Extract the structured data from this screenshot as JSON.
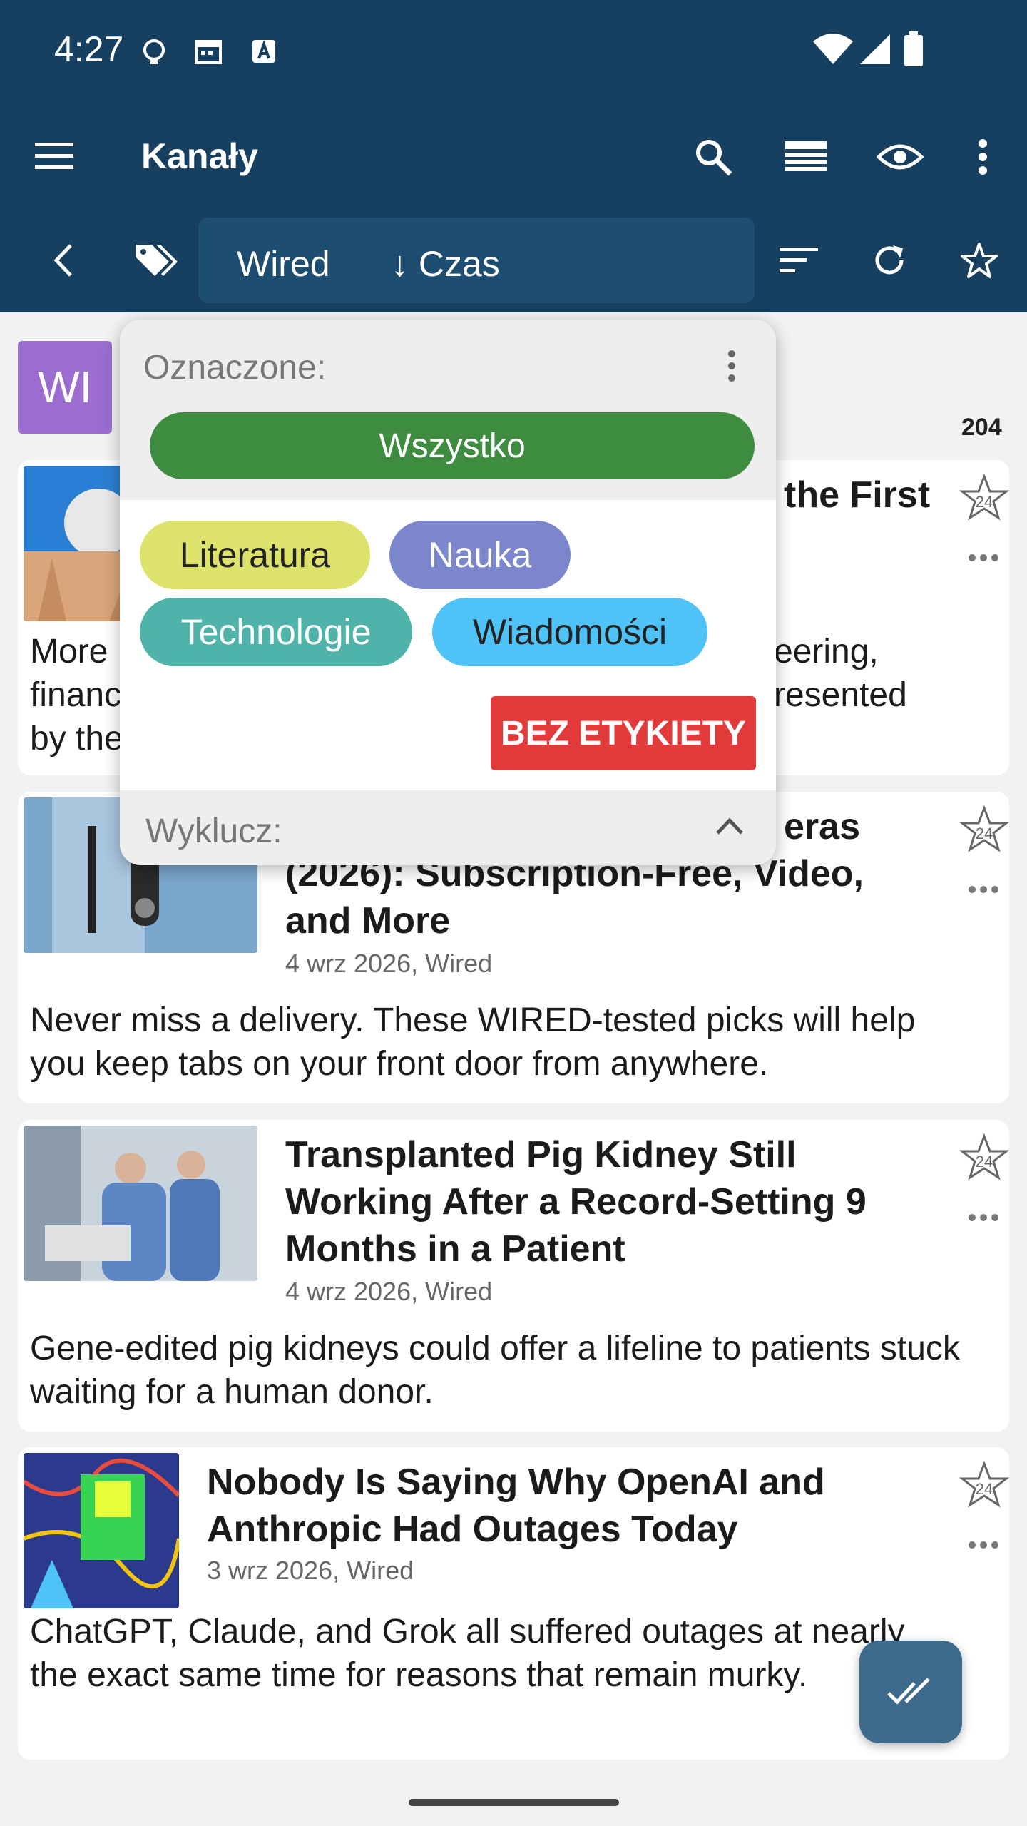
{
  "status_bar": {
    "time": "4:27"
  },
  "app_bar": {
    "title": "Kanały",
    "feed_name": "Wired",
    "sort_label": "↓ Czas"
  },
  "feed": {
    "avatar_text": "WI",
    "count": "204"
  },
  "articles": [
    {
      "title_visible": "the First",
      "summary_left": [
        "More",
        "financ",
        "by the"
      ],
      "summary_right": [
        "eering,",
        "resented"
      ]
    },
    {
      "title_visible_partial": "eras",
      "title_rest": "(2026): Subscription-Free, Video, and More",
      "meta": "4 wrz 2026, Wired",
      "summary": "Never miss a delivery. These WIRED-tested picks will help you keep tabs on your front door from anywhere."
    },
    {
      "title": "Transplanted Pig Kidney Still Working After a Record-Setting 9 Months in a Patient",
      "meta": "4 wrz 2026, Wired",
      "summary": "Gene-edited pig kidneys could offer a lifeline to patients stuck waiting for a human donor."
    },
    {
      "title": "Nobody Is Saying Why OpenAI and Anthropic Had Outages Today",
      "meta": "3 wrz 2026, Wired",
      "summary": "ChatGPT, Claude, and Grok all suffered outages at nearly the exact same time for reasons that remain murky."
    }
  ],
  "tag_popup": {
    "include_label": "Oznaczone:",
    "all_button": "Wszystko",
    "tags": [
      {
        "label": "Literatura",
        "color": "#dde26a"
      },
      {
        "label": "Nauka",
        "color": "#7b86cc"
      },
      {
        "label": "Technologie",
        "color": "#4fb3a9"
      },
      {
        "label": "Wiadomości",
        "color": "#4fc3f7"
      }
    ],
    "untagged_button": "BEZ ETYKIETY",
    "exclude_label": "Wyklucz:"
  },
  "colors": {
    "app_bar": "#173f5f",
    "filter_chip": "#1e4d72",
    "accent_green": "#3d8c40",
    "untagged_red": "#e03a3a",
    "fab": "#3e6a8c"
  }
}
